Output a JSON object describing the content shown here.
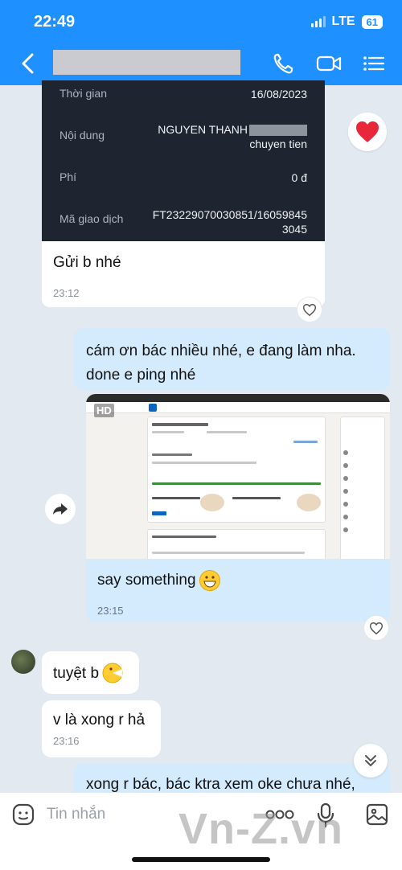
{
  "status": {
    "time": "22:49",
    "network": "LTE",
    "battery": "61"
  },
  "receipt": {
    "rows": [
      {
        "label": "Thời gian",
        "value": "16/08/2023"
      },
      {
        "label": "Nội dung",
        "value_line1": "NGUYEN THANH",
        "value_line2": "chuyen tien"
      },
      {
        "label": "Phí",
        "value": "0 đ"
      },
      {
        "label": "Mã giao dịch",
        "value_line1": "FT23229070030851/16059845",
        "value_line2": "3045"
      }
    ],
    "caption": "Gửi b nhé",
    "time": "23:12"
  },
  "messages": {
    "out1": {
      "line1": "cám ơn bác nhiều nhé, e đang làm nha.",
      "line2": "done e ping nhé"
    },
    "image": {
      "badge": "HD",
      "caption": "say something",
      "time": "23:15"
    },
    "in1": {
      "text": "tuyệt b"
    },
    "in2": {
      "text": "v là xong r hả",
      "time": "23:16"
    },
    "out2": {
      "text": "xong r bác, bác ktra xem oke chưa nhé,"
    }
  },
  "input": {
    "placeholder": "Tin nhắn"
  },
  "watermark": "Vn-Z.vn",
  "colors": {
    "header": "#1e90ff",
    "outgoing": "#d4ebfd",
    "incoming": "#ffffff",
    "background": "#e2e9f1"
  }
}
